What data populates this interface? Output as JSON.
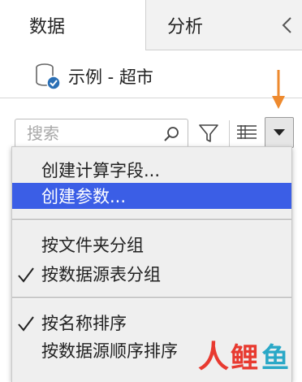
{
  "tabs": [
    {
      "label": "数据",
      "active": true
    },
    {
      "label": "分析",
      "active": false
    }
  ],
  "collapse_glyph": "‹",
  "datasource": {
    "name": "示例 - 超市",
    "icon": "database-icon"
  },
  "search": {
    "placeholder": "搜索",
    "value": ""
  },
  "toolbar_icons": [
    "search-icon",
    "filter-icon",
    "list-view-icon",
    "dropdown-arrow-icon"
  ],
  "annotation": {
    "color": "#ee8a2e",
    "icon": "arrow-down-icon"
  },
  "menu": {
    "items": [
      {
        "label": "创建计算字段...",
        "checked": false,
        "highlighted": false
      },
      {
        "label": "创建参数...",
        "checked": false,
        "highlighted": true
      },
      {
        "label": "按文件夹分组",
        "checked": false,
        "highlighted": false
      },
      {
        "label": "按数据源表分组",
        "checked": true,
        "highlighted": false
      },
      {
        "label": "按名称排序",
        "checked": true,
        "highlighted": false
      },
      {
        "label": "按数据源顺序排序",
        "checked": false,
        "highlighted": false
      }
    ],
    "highlight_color": "#3b5ee6"
  },
  "watermark": {
    "glyphs": [
      "人",
      "鲤",
      "鱼"
    ],
    "colors": [
      "#e83a30",
      "#e83a30",
      "#2aa8c7"
    ]
  }
}
